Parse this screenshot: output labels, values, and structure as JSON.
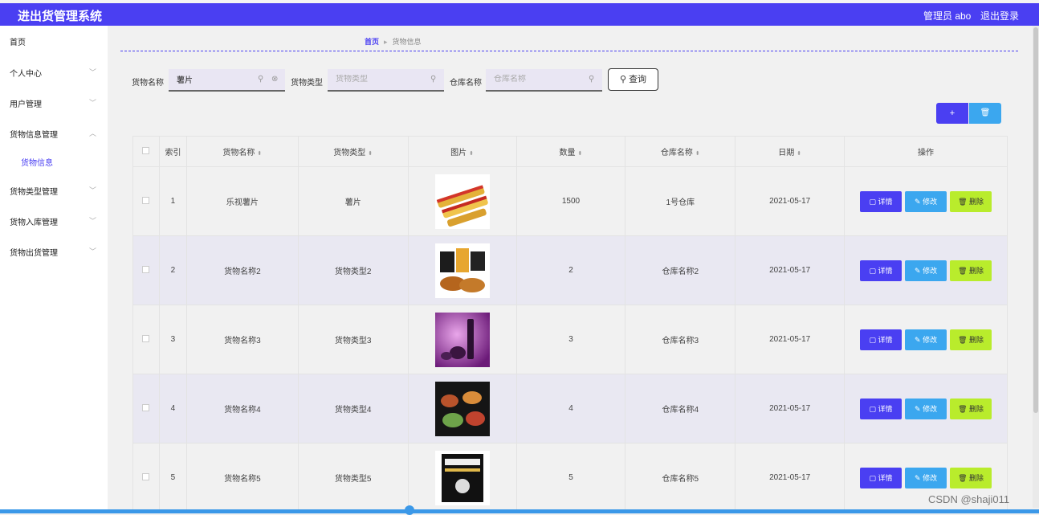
{
  "header": {
    "title": "进出货管理系统",
    "user": "管理员 abo",
    "logout": "退出登录"
  },
  "sidebar": {
    "items": [
      {
        "label": "首页"
      },
      {
        "label": "个人中心"
      },
      {
        "label": "用户管理"
      },
      {
        "label": "货物信息管理"
      },
      {
        "label": "货物类型管理"
      },
      {
        "label": "货物入库管理"
      },
      {
        "label": "货物出货管理"
      }
    ],
    "sub": "货物信息"
  },
  "breadcrumb": {
    "home": "首页",
    "current": "货物信息"
  },
  "search": {
    "name_label": "货物名称",
    "name_value": "薯片",
    "type_label": "货物类型",
    "type_placeholder": "货物类型",
    "warehouse_label": "仓库名称",
    "warehouse_placeholder": "仓库名称",
    "query_label": "查询"
  },
  "toolbar": {
    "add_label": "+",
    "delete_label": "🗑"
  },
  "table": {
    "headers": [
      "索引",
      "货物名称",
      "货物类型",
      "图片",
      "数量",
      "仓库名称",
      "日期",
      "操作"
    ],
    "rows": [
      {
        "index": "1",
        "name": "乐视薯片",
        "type": "薯片",
        "qty": "1500",
        "warehouse": "1号仓库",
        "date": "2021-05-17"
      },
      {
        "index": "2",
        "name": "货物名称2",
        "type": "货物类型2",
        "qty": "2",
        "warehouse": "仓库名称2",
        "date": "2021-05-17"
      },
      {
        "index": "3",
        "name": "货物名称3",
        "type": "货物类型3",
        "qty": "3",
        "warehouse": "仓库名称3",
        "date": "2021-05-17"
      },
      {
        "index": "4",
        "name": "货物名称4",
        "type": "货物类型4",
        "qty": "4",
        "warehouse": "仓库名称4",
        "date": "2021-05-17"
      },
      {
        "index": "5",
        "name": "货物名称5",
        "type": "货物类型5",
        "qty": "5",
        "warehouse": "仓库名称5",
        "date": "2021-05-17"
      }
    ],
    "actions": {
      "detail": "详情",
      "edit": "修改",
      "delete": "删除"
    }
  },
  "watermark": "CSDN @shaji011",
  "colors": {
    "primary": "#4a3ff2",
    "info": "#3ba7ef",
    "lime": "#b9ec2c"
  }
}
